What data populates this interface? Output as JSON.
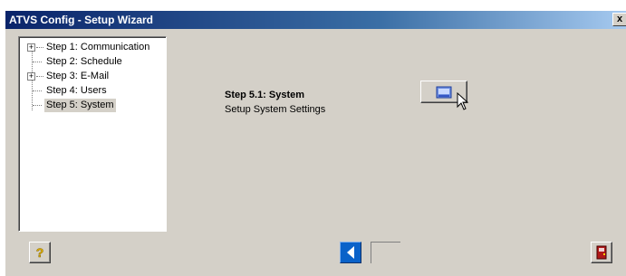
{
  "window": {
    "title": "ATVS Config - Setup Wizard",
    "close_label": "x"
  },
  "tree": {
    "items": [
      {
        "label": "Step 1: Communication",
        "expandable": true,
        "selected": false
      },
      {
        "label": "Step 2: Schedule",
        "expandable": false,
        "selected": false
      },
      {
        "label": "Step 3: E-Mail",
        "expandable": true,
        "selected": false
      },
      {
        "label": "Step 4: Users",
        "expandable": false,
        "selected": false
      },
      {
        "label": "Step 5: System",
        "expandable": false,
        "selected": true
      }
    ]
  },
  "step": {
    "title": "Step 5.1: System",
    "description": "Setup System Settings"
  },
  "buttons": {
    "settings_icon": "settings-window-icon",
    "help_icon": "question-mark-icon",
    "back_icon": "back-arrow-icon",
    "exit_icon": "exit-door-icon"
  },
  "colors": {
    "titlebar": "#0a246a",
    "face": "#d4d0c8",
    "back_button": "#0a62c9",
    "help_question": "#e0b000"
  }
}
